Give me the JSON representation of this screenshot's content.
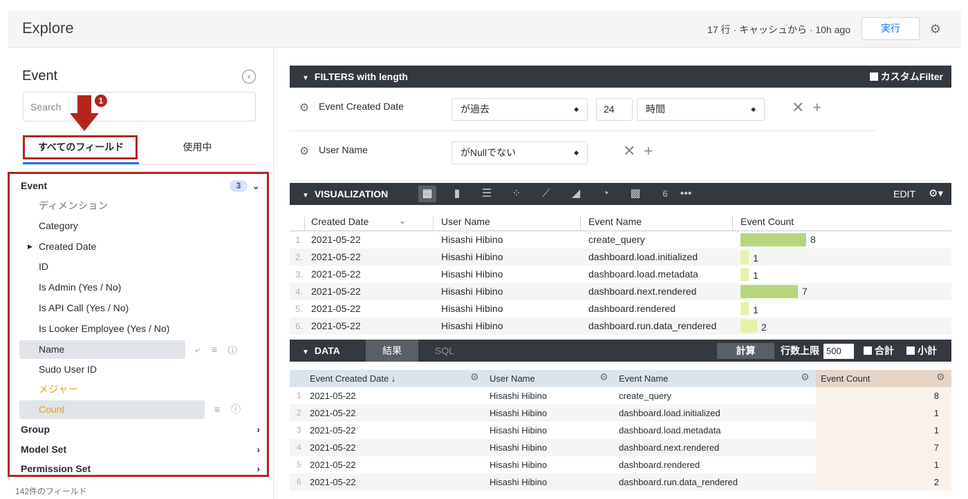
{
  "header": {
    "title": "Explore",
    "status": "17 行 · キャッシュから · 10h ago",
    "run_label": "実行",
    "settings_icon": "gear-icon"
  },
  "field_picker": {
    "title": "Event",
    "search_placeholder": "Search",
    "tabs": [
      "すべてのフィールド",
      "使用中"
    ],
    "annotation_badge": "1",
    "groups": {
      "event": {
        "label": "Event",
        "count": "3"
      },
      "dimensions_label": "ディメンション",
      "dimensions": [
        "Category",
        "Created Date",
        "ID",
        "Is Admin (Yes / No)",
        "Is API Call (Yes / No)",
        "Is Looker Employee (Yes / No)",
        "Name",
        "Sudo User ID"
      ],
      "measures_label": "メジャー",
      "measures": [
        "Count"
      ],
      "other_groups": [
        "Group",
        "Model Set",
        "Permission Set"
      ]
    },
    "field_count": "142件のフィールド"
  },
  "filters": {
    "title": "FILTERS with length",
    "custom_filter_label": "カスタムFilter",
    "rows": [
      {
        "label": "Event Created Date",
        "operator": "が過去",
        "value": "24",
        "unit": "時間"
      },
      {
        "label": "User Name",
        "operator": "がNullでない"
      }
    ]
  },
  "visualization": {
    "title": "VISUALIZATION",
    "edit_label": "EDIT",
    "type_icons": [
      "table-icon",
      "bar-chart-icon",
      "list-icon",
      "scatter-icon",
      "line-chart-icon",
      "area-chart-icon",
      "pie-chart-icon",
      "map-icon",
      "single-value-icon",
      "more-icon"
    ],
    "single_value_glyph": "6",
    "more_glyph": "•••",
    "columns": [
      "Created Date",
      "User Name",
      "Event Name",
      "Event Count"
    ]
  },
  "data": {
    "title": "DATA",
    "tab_results": "結果",
    "tab_sql": "SQL",
    "calculate_label": "計算",
    "row_limit_label": "行数上限",
    "row_limit_value": "500",
    "total_label": "合計",
    "subtotal_label": "小計",
    "columns": [
      "Event Created Date ↓",
      "User Name",
      "Event Name",
      "Event Count"
    ],
    "rows": [
      {
        "n": "1",
        "date": "2021-05-22",
        "user": "Hisashi Hibino",
        "event": "create_query",
        "count": 8
      },
      {
        "n": "2",
        "date": "2021-05-22",
        "user": "Hisashi Hibino",
        "event": "dashboard.load.initialized",
        "count": 1
      },
      {
        "n": "3",
        "date": "2021-05-22",
        "user": "Hisashi Hibino",
        "event": "dashboard.load.metadata",
        "count": 1
      },
      {
        "n": "4",
        "date": "2021-05-22",
        "user": "Hisashi Hibino",
        "event": "dashboard.next.rendered",
        "count": 7
      },
      {
        "n": "5",
        "date": "2021-05-22",
        "user": "Hisashi Hibino",
        "event": "dashboard.rendered",
        "count": 1
      },
      {
        "n": "6",
        "date": "2021-05-22",
        "user": "Hisashi Hibino",
        "event": "dashboard.run.data_rendered",
        "count": 2
      }
    ]
  },
  "colors": {
    "bar_high": "#b5d67d",
    "bar_low": "#e5f2a8",
    "annotation": "#b3261e",
    "accent": "#1a73e8"
  }
}
